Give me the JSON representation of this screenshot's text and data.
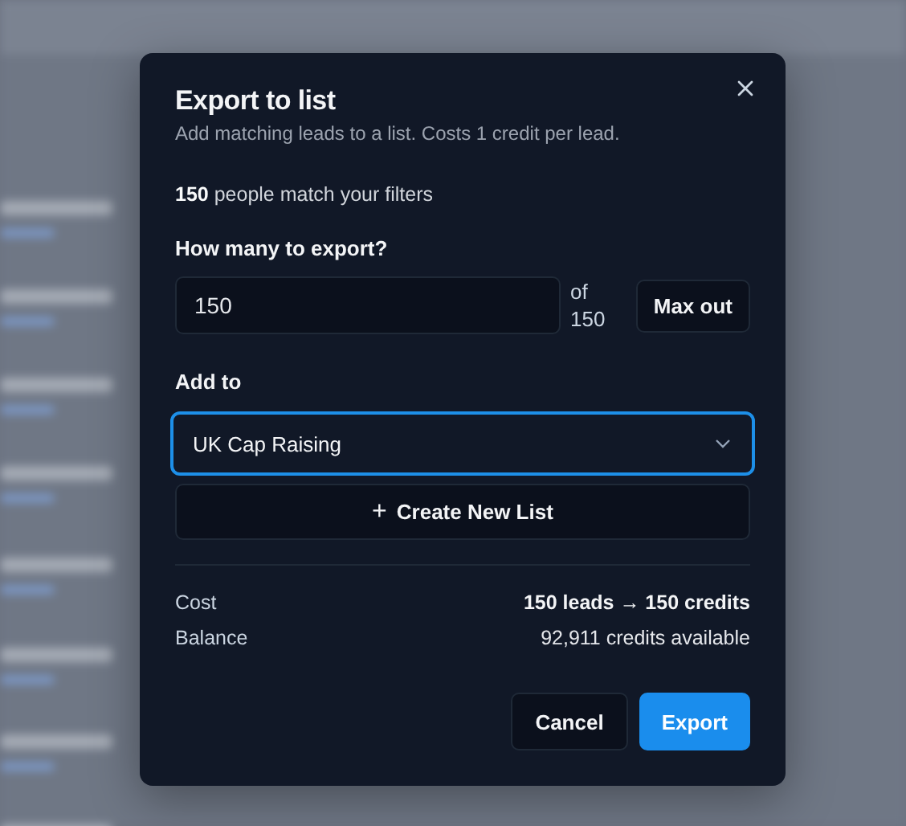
{
  "dialog": {
    "title": "Export to list",
    "subtitle": "Add matching leads to a list. Costs 1 credit per lead.",
    "match_summary": "**150** people match your filters",
    "quantity": {
      "label": "How many to export?",
      "value": "150",
      "of_label": "of",
      "total": "150",
      "max_button": "Max out"
    },
    "list": {
      "label": "Add to",
      "value": "UK Cap Raising",
      "focused": true
    },
    "create_button": {
      "icon": "+",
      "label": "Create New List"
    },
    "summary": [
      {
        "label": "Cost",
        "value": "150 leads → 150 credits",
        "bold": true
      },
      {
        "label": "Balance",
        "value": "92,911 credits available",
        "bold": false
      }
    ],
    "buttons": [
      {
        "label": "Cancel",
        "kind": "secondary"
      },
      {
        "label": "Export",
        "kind": "primary"
      }
    ]
  }
}
